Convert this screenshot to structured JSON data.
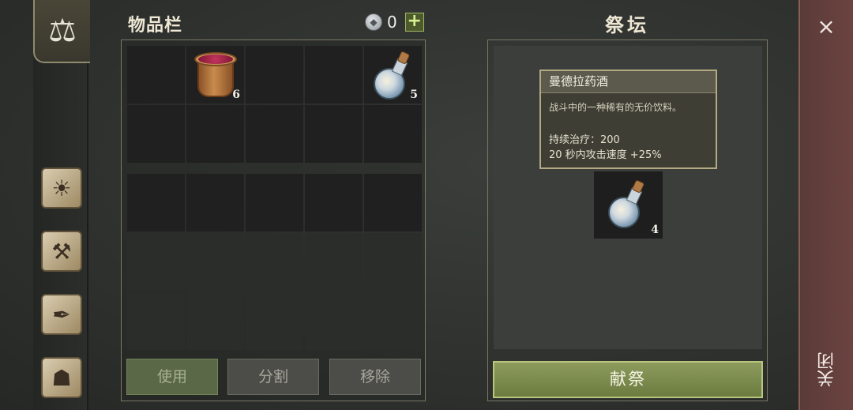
{
  "inventory": {
    "title": "物品栏",
    "currency_amount": "0",
    "add_label": "+",
    "slots_top": [
      {
        "item": "",
        "qty": ""
      },
      {
        "item": "berry-bucket",
        "qty": "6"
      },
      {
        "item": "",
        "qty": ""
      },
      {
        "item": "",
        "qty": ""
      },
      {
        "item": "mandrake-potion",
        "qty": "5"
      },
      {
        "item": "",
        "qty": ""
      },
      {
        "item": "",
        "qty": ""
      },
      {
        "item": "",
        "qty": ""
      },
      {
        "item": "",
        "qty": ""
      },
      {
        "item": "",
        "qty": ""
      }
    ],
    "buttons": {
      "use": "使用",
      "split": "分割",
      "remove": "移除"
    }
  },
  "altar": {
    "title": "祭坛",
    "tooltip": {
      "name": "曼德拉药酒",
      "description": "战斗中的一种稀有的无价饮料。",
      "stat_heal": "持续治疗：200",
      "stat_speed": "20 秒内攻击速度 +25%"
    },
    "slot_qty": "4",
    "offer_label": "献祭"
  },
  "close": {
    "icon": "×",
    "label": "关闭"
  },
  "rail_icons": [
    "scale-icon",
    "sun-book-icon",
    "hammer-map-icon",
    "quill-scroll-icon",
    "character-icon"
  ]
}
